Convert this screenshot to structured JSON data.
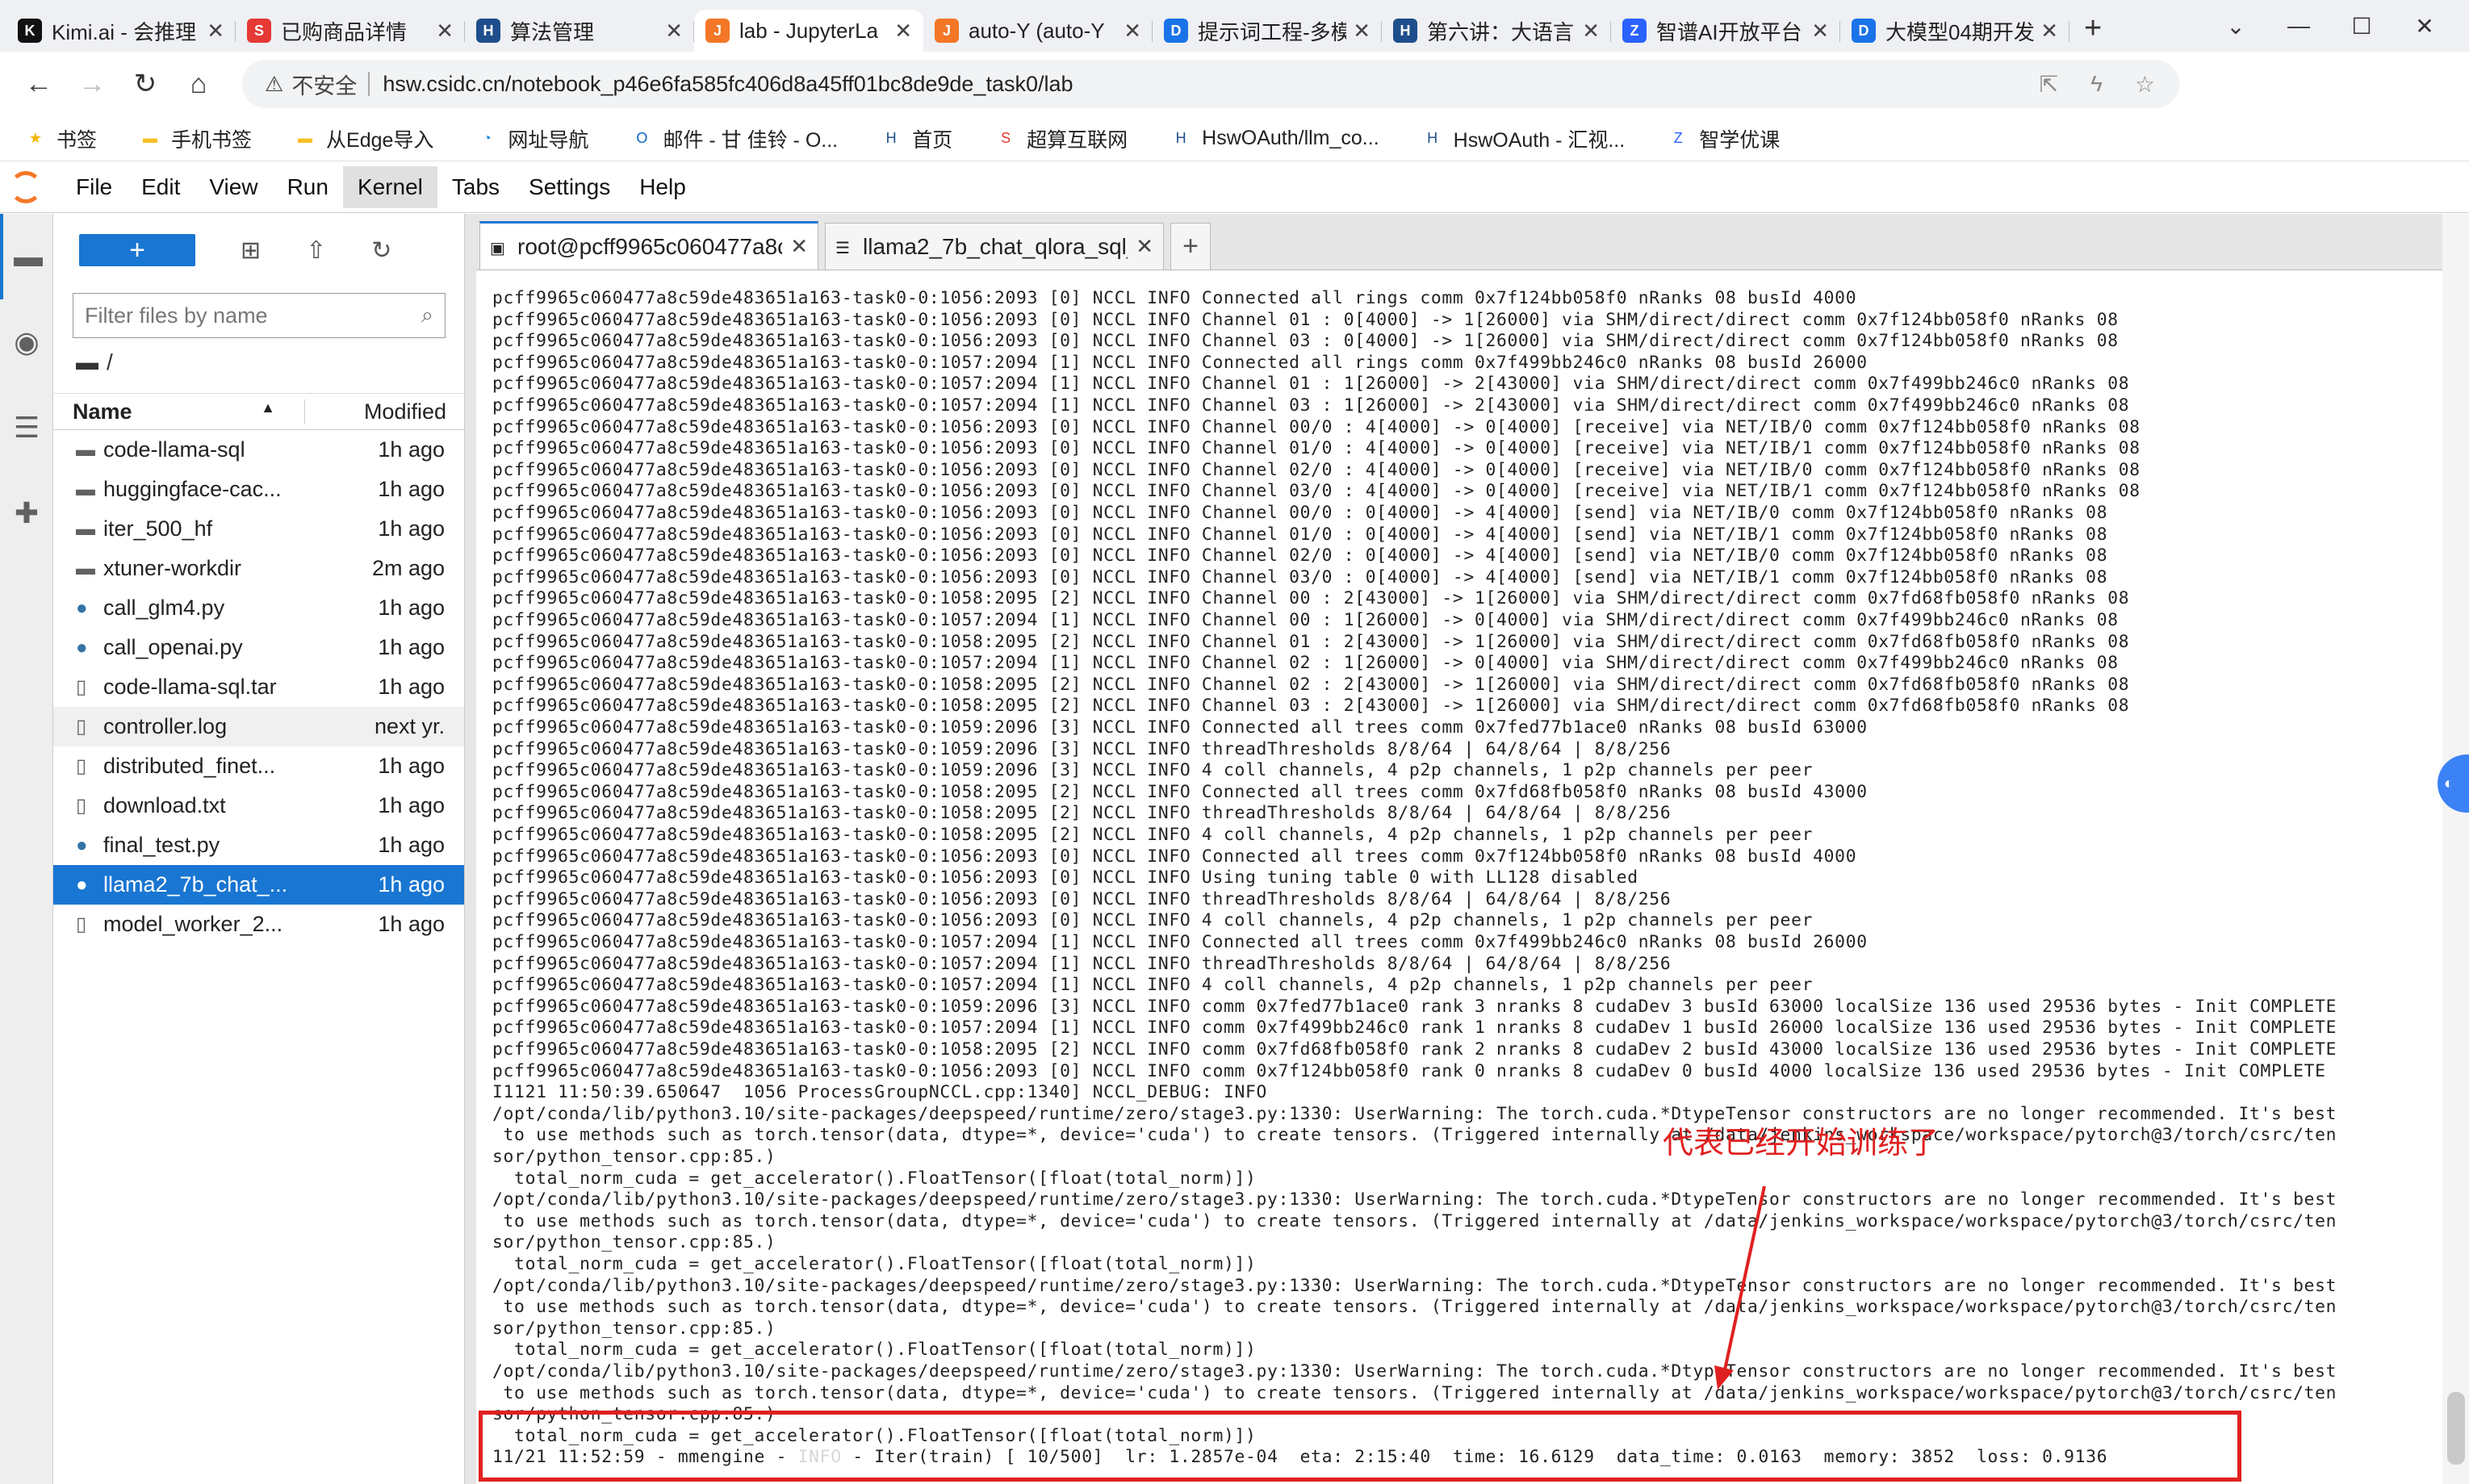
{
  "browser": {
    "tabs": [
      {
        "title": "Kimi.ai - 会推理",
        "icon": "kimi-icon",
        "color": "#111111",
        "glyph": "K"
      },
      {
        "title": "已购商品详情",
        "icon": "scnet-icon",
        "color": "#e53935",
        "glyph": "S"
      },
      {
        "title": "算法管理",
        "icon": "hsw-icon",
        "color": "#1e4e8c",
        "glyph": "H"
      },
      {
        "title": "lab - JupyterLa",
        "icon": "jupyter-icon",
        "color": "#f37726",
        "glyph": "J",
        "active": true
      },
      {
        "title": "auto-Y (auto-Y",
        "icon": "jupyter-icon",
        "color": "#f37726",
        "glyph": "J"
      },
      {
        "title": "提示词工程-多模",
        "icon": "doc-icon",
        "color": "#1a73e8",
        "glyph": "D"
      },
      {
        "title": "第六讲：大语言",
        "icon": "hsw-icon",
        "color": "#1e4e8c",
        "glyph": "H"
      },
      {
        "title": "智谱AI开放平台",
        "icon": "zhipu-icon",
        "color": "#2962ff",
        "glyph": "Z"
      },
      {
        "title": "大模型04期开发",
        "icon": "doc-icon",
        "color": "#1a73e8",
        "glyph": "D"
      }
    ],
    "url_warning": "不安全",
    "url": "hsw.csidc.cn/notebook_p46e6fa585fc406d8a45ff01bc8de9de_task0/lab",
    "bookmarks": [
      {
        "label": "书签",
        "icon": "star-icon"
      },
      {
        "label": "手机书签",
        "icon": "folder-icon"
      },
      {
        "label": "从Edge导入",
        "icon": "folder-icon"
      },
      {
        "label": "网址导航",
        "icon": "nav-icon"
      },
      {
        "label": "邮件 - 甘 佳铃 - O...",
        "icon": "outlook-icon"
      },
      {
        "label": "首页",
        "icon": "hsw-icon"
      },
      {
        "label": "超算互联网",
        "icon": "scnet-icon"
      },
      {
        "label": "HswOAuth/llm_co...",
        "icon": "hsw-icon"
      },
      {
        "label": "HswOAuth - 汇视...",
        "icon": "hsw-icon"
      },
      {
        "label": "智学优课",
        "icon": "zhixue-icon"
      }
    ]
  },
  "jupyter": {
    "menu": [
      "File",
      "Edit",
      "View",
      "Run",
      "Kernel",
      "Tabs",
      "Settings",
      "Help"
    ],
    "open_menu": "Kernel",
    "filebrowser": {
      "new_label": "+",
      "filter_placeholder": "Filter files by name",
      "path": "/",
      "col_name": "Name",
      "col_modified": "Modified",
      "files": [
        {
          "name": "code-llama-sql",
          "modified": "1h ago",
          "type": "folder"
        },
        {
          "name": "huggingface-cac...",
          "modified": "1h ago",
          "type": "folder"
        },
        {
          "name": "iter_500_hf",
          "modified": "1h ago",
          "type": "folder"
        },
        {
          "name": "xtuner-workdir",
          "modified": "2m ago",
          "type": "folder"
        },
        {
          "name": "call_glm4.py",
          "modified": "1h ago",
          "type": "python"
        },
        {
          "name": "call_openai.py",
          "modified": "1h ago",
          "type": "python"
        },
        {
          "name": "code-llama-sql.tar",
          "modified": "1h ago",
          "type": "file"
        },
        {
          "name": "controller.log",
          "modified": "next yr.",
          "type": "file",
          "highlight": true
        },
        {
          "name": "distributed_finet...",
          "modified": "1h ago",
          "type": "file"
        },
        {
          "name": "download.txt",
          "modified": "1h ago",
          "type": "file"
        },
        {
          "name": "final_test.py",
          "modified": "1h ago",
          "type": "python"
        },
        {
          "name": "llama2_7b_chat_...",
          "modified": "1h ago",
          "type": "python",
          "selected": true
        },
        {
          "name": "model_worker_2...",
          "modified": "1h ago",
          "type": "file"
        }
      ]
    },
    "doc_tabs": [
      {
        "title": "root@pcff9965c060477a8c",
        "icon": "terminal-icon",
        "current": true
      },
      {
        "title": "llama2_7b_chat_qlora_sql_",
        "icon": "file-icon",
        "current": false
      }
    ]
  },
  "terminal": {
    "lines": [
      "pcff9965c060477a8c59de483651a163-task0-0:1056:2093 [0] NCCL INFO Connected all rings comm 0x7f124bb058f0 nRanks 08 busId 4000",
      "pcff9965c060477a8c59de483651a163-task0-0:1056:2093 [0] NCCL INFO Channel 01 : 0[4000] -> 1[26000] via SHM/direct/direct comm 0x7f124bb058f0 nRanks 08",
      "pcff9965c060477a8c59de483651a163-task0-0:1056:2093 [0] NCCL INFO Channel 03 : 0[4000] -> 1[26000] via SHM/direct/direct comm 0x7f124bb058f0 nRanks 08",
      "pcff9965c060477a8c59de483651a163-task0-0:1057:2094 [1] NCCL INFO Connected all rings comm 0x7f499bb246c0 nRanks 08 busId 26000",
      "pcff9965c060477a8c59de483651a163-task0-0:1057:2094 [1] NCCL INFO Channel 01 : 1[26000] -> 2[43000] via SHM/direct/direct comm 0x7f499bb246c0 nRanks 08",
      "pcff9965c060477a8c59de483651a163-task0-0:1057:2094 [1] NCCL INFO Channel 03 : 1[26000] -> 2[43000] via SHM/direct/direct comm 0x7f499bb246c0 nRanks 08",
      "pcff9965c060477a8c59de483651a163-task0-0:1056:2093 [0] NCCL INFO Channel 00/0 : 4[4000] -> 0[4000] [receive] via NET/IB/0 comm 0x7f124bb058f0 nRanks 08",
      "pcff9965c060477a8c59de483651a163-task0-0:1056:2093 [0] NCCL INFO Channel 01/0 : 4[4000] -> 0[4000] [receive] via NET/IB/1 comm 0x7f124bb058f0 nRanks 08",
      "pcff9965c060477a8c59de483651a163-task0-0:1056:2093 [0] NCCL INFO Channel 02/0 : 4[4000] -> 0[4000] [receive] via NET/IB/0 comm 0x7f124bb058f0 nRanks 08",
      "pcff9965c060477a8c59de483651a163-task0-0:1056:2093 [0] NCCL INFO Channel 03/0 : 4[4000] -> 0[4000] [receive] via NET/IB/1 comm 0x7f124bb058f0 nRanks 08",
      "pcff9965c060477a8c59de483651a163-task0-0:1056:2093 [0] NCCL INFO Channel 00/0 : 0[4000] -> 4[4000] [send] via NET/IB/0 comm 0x7f124bb058f0 nRanks 08",
      "pcff9965c060477a8c59de483651a163-task0-0:1056:2093 [0] NCCL INFO Channel 01/0 : 0[4000] -> 4[4000] [send] via NET/IB/1 comm 0x7f124bb058f0 nRanks 08",
      "pcff9965c060477a8c59de483651a163-task0-0:1056:2093 [0] NCCL INFO Channel 02/0 : 0[4000] -> 4[4000] [send] via NET/IB/0 comm 0x7f124bb058f0 nRanks 08",
      "pcff9965c060477a8c59de483651a163-task0-0:1056:2093 [0] NCCL INFO Channel 03/0 : 0[4000] -> 4[4000] [send] via NET/IB/1 comm 0x7f124bb058f0 nRanks 08",
      "pcff9965c060477a8c59de483651a163-task0-0:1058:2095 [2] NCCL INFO Channel 00 : 2[43000] -> 1[26000] via SHM/direct/direct comm 0x7fd68fb058f0 nRanks 08",
      "pcff9965c060477a8c59de483651a163-task0-0:1057:2094 [1] NCCL INFO Channel 00 : 1[26000] -> 0[4000] via SHM/direct/direct comm 0x7f499bb246c0 nRanks 08",
      "pcff9965c060477a8c59de483651a163-task0-0:1058:2095 [2] NCCL INFO Channel 01 : 2[43000] -> 1[26000] via SHM/direct/direct comm 0x7fd68fb058f0 nRanks 08",
      "pcff9965c060477a8c59de483651a163-task0-0:1057:2094 [1] NCCL INFO Channel 02 : 1[26000] -> 0[4000] via SHM/direct/direct comm 0x7f499bb246c0 nRanks 08",
      "pcff9965c060477a8c59de483651a163-task0-0:1058:2095 [2] NCCL INFO Channel 02 : 2[43000] -> 1[26000] via SHM/direct/direct comm 0x7fd68fb058f0 nRanks 08",
      "pcff9965c060477a8c59de483651a163-task0-0:1058:2095 [2] NCCL INFO Channel 03 : 2[43000] -> 1[26000] via SHM/direct/direct comm 0x7fd68fb058f0 nRanks 08",
      "pcff9965c060477a8c59de483651a163-task0-0:1059:2096 [3] NCCL INFO Connected all trees comm 0x7fed77b1ace0 nRanks 08 busId 63000",
      "pcff9965c060477a8c59de483651a163-task0-0:1059:2096 [3] NCCL INFO threadThresholds 8/8/64 | 64/8/64 | 8/8/256",
      "pcff9965c060477a8c59de483651a163-task0-0:1059:2096 [3] NCCL INFO 4 coll channels, 4 p2p channels, 1 p2p channels per peer",
      "pcff9965c060477a8c59de483651a163-task0-0:1058:2095 [2] NCCL INFO Connected all trees comm 0x7fd68fb058f0 nRanks 08 busId 43000",
      "pcff9965c060477a8c59de483651a163-task0-0:1058:2095 [2] NCCL INFO threadThresholds 8/8/64 | 64/8/64 | 8/8/256",
      "pcff9965c060477a8c59de483651a163-task0-0:1058:2095 [2] NCCL INFO 4 coll channels, 4 p2p channels, 1 p2p channels per peer",
      "pcff9965c060477a8c59de483651a163-task0-0:1056:2093 [0] NCCL INFO Connected all trees comm 0x7f124bb058f0 nRanks 08 busId 4000",
      "pcff9965c060477a8c59de483651a163-task0-0:1056:2093 [0] NCCL INFO Using tuning table 0 with LL128 disabled",
      "pcff9965c060477a8c59de483651a163-task0-0:1056:2093 [0] NCCL INFO threadThresholds 8/8/64 | 64/8/64 | 8/8/256",
      "pcff9965c060477a8c59de483651a163-task0-0:1056:2093 [0] NCCL INFO 4 coll channels, 4 p2p channels, 1 p2p channels per peer",
      "pcff9965c060477a8c59de483651a163-task0-0:1057:2094 [1] NCCL INFO Connected all trees comm 0x7f499bb246c0 nRanks 08 busId 26000",
      "pcff9965c060477a8c59de483651a163-task0-0:1057:2094 [1] NCCL INFO threadThresholds 8/8/64 | 64/8/64 | 8/8/256",
      "pcff9965c060477a8c59de483651a163-task0-0:1057:2094 [1] NCCL INFO 4 coll channels, 4 p2p channels, 1 p2p channels per peer",
      "pcff9965c060477a8c59de483651a163-task0-0:1059:2096 [3] NCCL INFO comm 0x7fed77b1ace0 rank 3 nranks 8 cudaDev 3 busId 63000 localSize 136 used 29536 bytes - Init COMPLETE",
      "pcff9965c060477a8c59de483651a163-task0-0:1057:2094 [1] NCCL INFO comm 0x7f499bb246c0 rank 1 nranks 8 cudaDev 1 busId 26000 localSize 136 used 29536 bytes - Init COMPLETE",
      "pcff9965c060477a8c59de483651a163-task0-0:1058:2095 [2] NCCL INFO comm 0x7fd68fb058f0 rank 2 nranks 8 cudaDev 2 busId 43000 localSize 136 used 29536 bytes - Init COMPLETE",
      "pcff9965c060477a8c59de483651a163-task0-0:1056:2093 [0] NCCL INFO comm 0x7f124bb058f0 rank 0 nranks 8 cudaDev 0 busId 4000 localSize 136 used 29536 bytes - Init COMPLETE",
      "I1121 11:50:39.650647  1056 ProcessGroupNCCL.cpp:1340] NCCL_DEBUG: INFO",
      "/opt/conda/lib/python3.10/site-packages/deepspeed/runtime/zero/stage3.py:1330: UserWarning: The torch.cuda.*DtypeTensor constructors are no longer recommended. It's best",
      " to use methods such as torch.tensor(data, dtype=*, device='cuda') to create tensors. (Triggered internally at /data/jenkins_workspace/workspace/pytorch@3/torch/csrc/ten",
      "sor/python_tensor.cpp:85.)",
      "  total_norm_cuda = get_accelerator().FloatTensor([float(total_norm)])",
      "/opt/conda/lib/python3.10/site-packages/deepspeed/runtime/zero/stage3.py:1330: UserWarning: The torch.cuda.*DtypeTensor constructors are no longer recommended. It's best",
      " to use methods such as torch.tensor(data, dtype=*, device='cuda') to create tensors. (Triggered internally at /data/jenkins_workspace/workspace/pytorch@3/torch/csrc/ten",
      "sor/python_tensor.cpp:85.)",
      "  total_norm_cuda = get_accelerator().FloatTensor([float(total_norm)])",
      "/opt/conda/lib/python3.10/site-packages/deepspeed/runtime/zero/stage3.py:1330: UserWarning: The torch.cuda.*DtypeTensor constructors are no longer recommended. It's best",
      " to use methods such as torch.tensor(data, dtype=*, device='cuda') to create tensors. (Triggered internally at /data/jenkins_workspace/workspace/pytorch@3/torch/csrc/ten",
      "sor/python_tensor.cpp:85.)",
      "  total_norm_cuda = get_accelerator().FloatTensor([float(total_norm)])",
      "/opt/conda/lib/python3.10/site-packages/deepspeed/runtime/zero/stage3.py:1330: UserWarning: The torch.cuda.*DtypeTensor constructors are no longer recommended. It's best",
      " to use methods such as torch.tensor(data, dtype=*, device='cuda') to create tensors. (Triggered internally at /data/jenkins_workspace/workspace/pytorch@3/torch/csrc/ten",
      "sor/python_tensor.cpp:85.)",
      "  total_norm_cuda = get_accelerator().FloatTensor([float(total_norm)])"
    ],
    "last_line": {
      "before": "11/21 11:52:59 - mmengine - ",
      "faded": "INFO",
      "after": " - Iter(train) [ 10/500]  lr: 1.2857e-04  eta: 2:15:40  time: 16.6129  data_time: 0.0163  memory: 3852  loss: 0.9136"
    }
  },
  "annotation": {
    "text": "代表已经开始训练了",
    "color": "#e02020"
  }
}
